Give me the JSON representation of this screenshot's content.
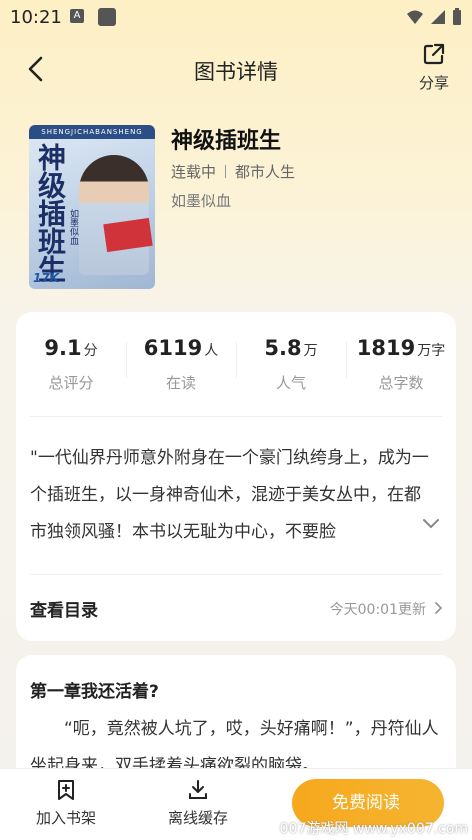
{
  "status": {
    "time": "10:21",
    "a_badge": "A"
  },
  "nav": {
    "title": "图书详情",
    "share_label": "分享"
  },
  "book": {
    "title": "神级插班生",
    "status": "连载中",
    "category": "都市人生",
    "author": "如墨似血",
    "cover": {
      "top_text": "SHENGJICHABANSHENG",
      "title": "神级插班生",
      "author": "如墨似血",
      "logo": "17K"
    }
  },
  "stats": [
    {
      "value": "9.1",
      "unit": "分",
      "label": "总评分"
    },
    {
      "value": "6119",
      "unit": "人",
      "label": "在读"
    },
    {
      "value": "5.8",
      "unit": "万",
      "label": "人气"
    },
    {
      "value": "1819",
      "unit": "万字",
      "label": "总字数"
    }
  ],
  "synopsis": "\"一代仙界丹师意外附身在一个豪门纨绔身上，成为一个插班生，以一身神奇仙术，混迹于美女丛中，在都市独领风骚！本书以无耻为中心，不要脸",
  "catalog": {
    "label": "查看目录",
    "update": "今天00:01更新"
  },
  "chapter": {
    "title": "第一章我还活着?",
    "text": "“呃，竟然被人坑了，哎，头好痛啊！”，丹符仙人坐起身来，双手揉着头痛欲裂的脑袋。"
  },
  "bottom": {
    "add_shelf": "加入书架",
    "offline": "离线缓存",
    "read": "免费阅读"
  },
  "watermark": "007游戏网 www.yx007.com",
  "colors": {
    "accent": "#f7a81c",
    "bg_top": "#fdf0c4"
  }
}
